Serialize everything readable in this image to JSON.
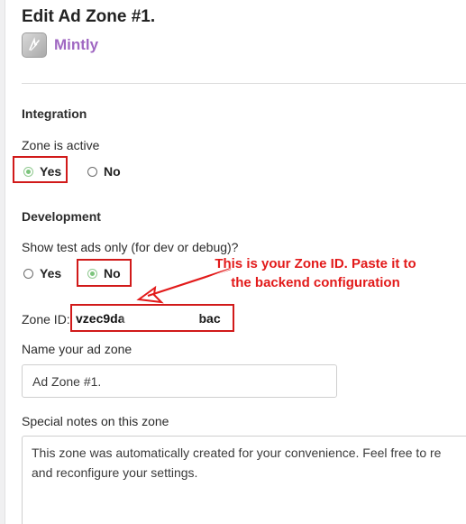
{
  "page": {
    "title": "Edit Ad Zone #1.",
    "brand_name": "Mintly"
  },
  "integration": {
    "heading": "Integration",
    "zone_active_label": "Zone is active",
    "options": [
      "Yes",
      "No"
    ],
    "selected": "Yes"
  },
  "development": {
    "heading": "Development",
    "test_ads_label": "Show test ads only (for dev or debug)?",
    "options": [
      "Yes",
      "No"
    ],
    "selected": "No"
  },
  "zone_id": {
    "label": "Zone ID:",
    "value_start": "vzec9da",
    "value_end": "bac"
  },
  "annotation": {
    "text_line1": "This is your Zone ID. Paste it to",
    "text_line2": "the backend configuration",
    "color": "#e21a1a"
  },
  "name_field": {
    "label": "Name your ad zone",
    "value": "Ad Zone #1."
  },
  "notes_field": {
    "label": "Special notes on this zone",
    "value": "This zone was automatically created for your convenience. Feel free to re\nand reconfigure your settings."
  }
}
